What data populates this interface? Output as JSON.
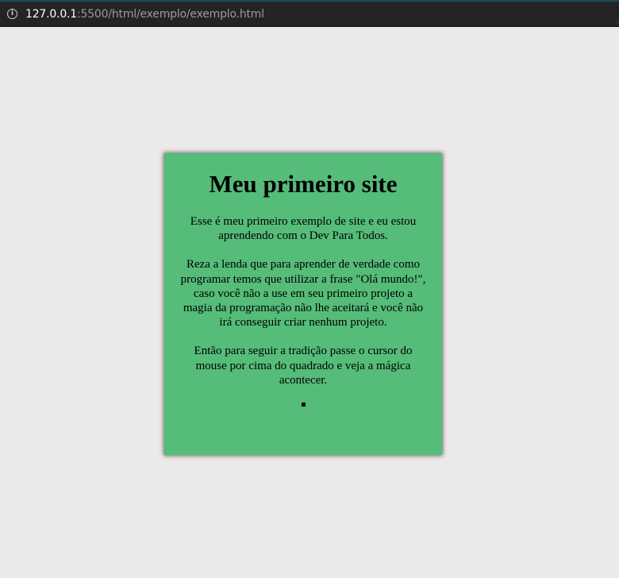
{
  "browser": {
    "url_host": "127.0.0.1",
    "url_path": ":5500/html/exemplo/exemplo.html",
    "info_glyph": "i"
  },
  "card": {
    "title": "Meu primeiro site",
    "paragraphs": [
      "Esse é meu primeiro exemplo de site e eu estou aprendendo com o Dev Para Todos.",
      "Reza a lenda que para aprender de verdade como programar temos que utilizar a frase \"Olá mundo!\", caso você não a use em seu primeiro projeto a magia da programação não lhe aceitará e você não irá conseguir criar nenhum projeto.",
      "Então para seguir a tradição passe o cursor do mouse por cima do quadrado e veja a mágica acontecer."
    ]
  },
  "colors": {
    "card_background": "#55bc79",
    "page_background": "#ebeae8",
    "browser_bar": "#242424"
  }
}
